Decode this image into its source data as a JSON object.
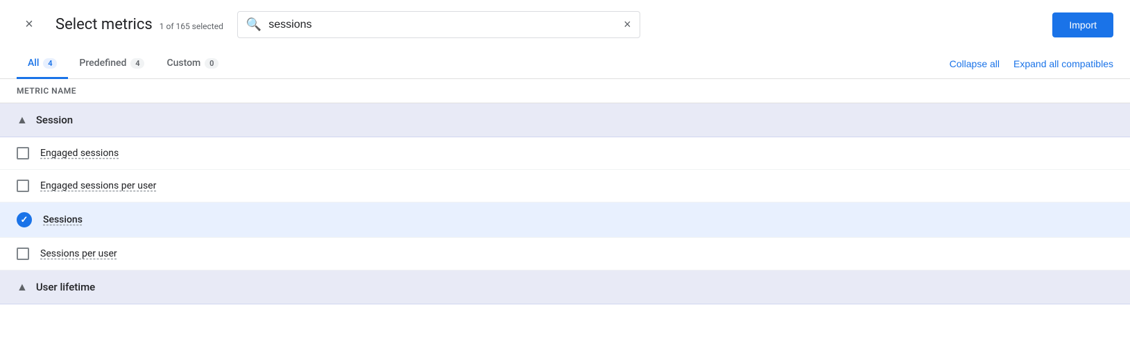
{
  "header": {
    "close_label": "×",
    "title": "Select metrics",
    "subtitle": "1 of 165 selected",
    "search_placeholder": "sessions",
    "search_value": "sessions",
    "clear_icon": "×",
    "import_label": "Import"
  },
  "tabs": {
    "items": [
      {
        "id": "all",
        "label": "All",
        "badge": "4",
        "active": true
      },
      {
        "id": "predefined",
        "label": "Predefined",
        "badge": "4",
        "active": false
      },
      {
        "id": "custom",
        "label": "Custom",
        "badge": "0",
        "active": false
      }
    ],
    "collapse_all_label": "Collapse all",
    "expand_all_label": "Expand all compatibles"
  },
  "table": {
    "column_header": "Metric name",
    "groups": [
      {
        "id": "session",
        "label": "Session",
        "expanded": true,
        "chevron": "▲",
        "metrics": [
          {
            "id": "engaged-sessions",
            "label": "Engaged sessions",
            "checked": false,
            "selected": false
          },
          {
            "id": "engaged-sessions-per-user",
            "label": "Engaged sessions per user",
            "checked": false,
            "selected": false
          },
          {
            "id": "sessions",
            "label": "Sessions",
            "checked": true,
            "selected": true
          },
          {
            "id": "sessions-per-user",
            "label": "Sessions per user",
            "checked": false,
            "selected": false
          }
        ]
      },
      {
        "id": "user-lifetime",
        "label": "User lifetime",
        "expanded": true,
        "chevron": "▲",
        "metrics": []
      }
    ]
  }
}
